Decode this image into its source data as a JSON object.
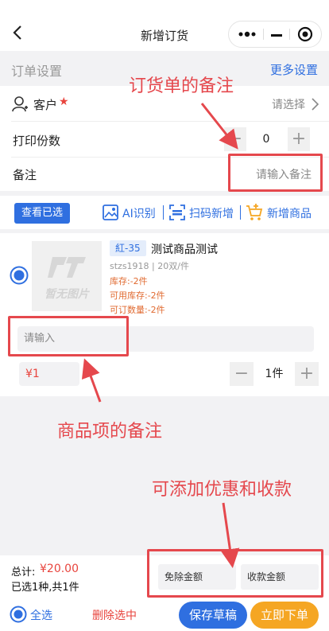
{
  "header": {
    "title": "新增订货",
    "back_icon": "back-arrow-icon",
    "more_icon": "more-dots-icon",
    "minimize_icon": "minimize-icon",
    "close_icon": "target-close-icon"
  },
  "order_settings": {
    "title": "订单设置",
    "more_settings": "更多设置"
  },
  "customer": {
    "label": "客户",
    "required_mark": "★",
    "placeholder": "请选择",
    "icon": "user-icon"
  },
  "print_copies": {
    "label": "打印份数",
    "value": "0",
    "minus": "−",
    "plus": "+"
  },
  "remark": {
    "label": "备注",
    "placeholder": "请输入备注"
  },
  "toolbar": {
    "view_selected": "查看已选",
    "ai_recognize": "AI识别",
    "scan_add": "扫码新增",
    "new_product": "新增商品"
  },
  "product": {
    "placeholder_image_text": "暂无图片",
    "tag": "紅-35",
    "name": "测试商品测试",
    "sku_info": "stzs1918 | 20双/件",
    "stock": "库存:-2件",
    "available_stock": "可用库存:-2件",
    "orderable_qty": "可订数量:-2件",
    "remark_placeholder": "请输入",
    "price": "¥1",
    "quantity": "1件",
    "minus": "−",
    "plus": "+"
  },
  "footer": {
    "total_label": "总计:",
    "total_value": "¥20.00",
    "selected_summary": "已选1种,共1件",
    "discount_amount": "免除金额",
    "payment_amount": "收款金额",
    "select_all": "全选",
    "delete_selected": "删除选中",
    "save_draft": "保存草稿",
    "place_order": "立即下单"
  },
  "annotations": {
    "order_remark": "订货单的备注",
    "item_remark": "商品项的备注",
    "discount_payment": "可添加优惠和收款"
  },
  "colors": {
    "accent_blue": "#2f6fe0",
    "orange": "#f5a623",
    "annotation_red": "#e5484d",
    "price_red": "#e8443d"
  }
}
